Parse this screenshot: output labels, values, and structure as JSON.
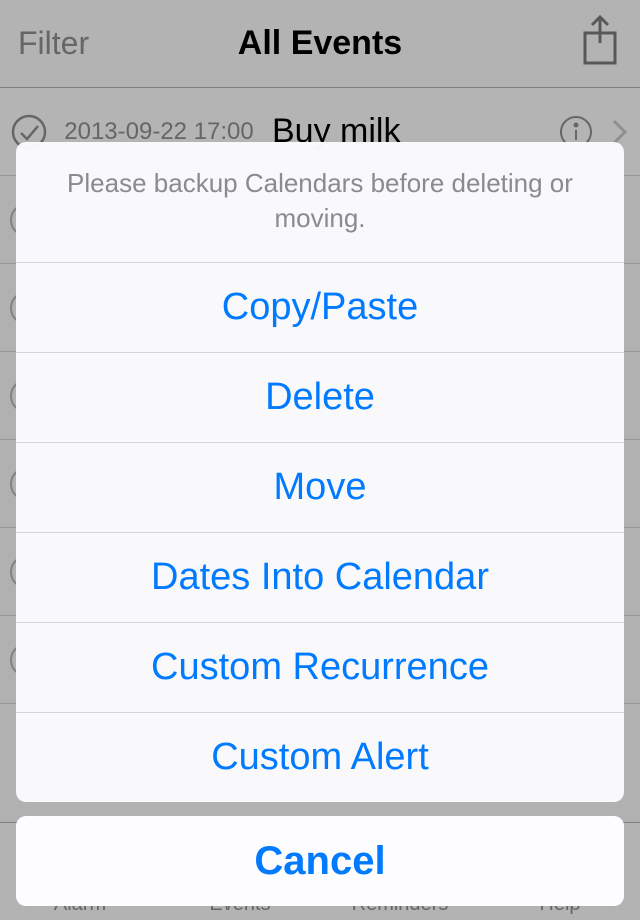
{
  "navbar": {
    "left_label": "Filter",
    "title": "All Events"
  },
  "event": {
    "datetime": "2013-09-22 17:00",
    "title": "Buy milk"
  },
  "tabbar": {
    "items": [
      "Alarm",
      "Events",
      "Reminders",
      "Help"
    ]
  },
  "action_sheet": {
    "message": "Please backup Calendars before deleting or moving.",
    "options": [
      "Copy/Paste",
      "Delete",
      "Move",
      "Dates Into Calendar",
      "Custom Recurrence",
      "Custom Alert"
    ],
    "cancel": "Cancel"
  }
}
